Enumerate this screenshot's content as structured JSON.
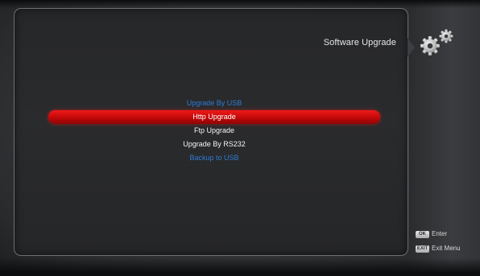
{
  "header": {
    "title": "Software Upgrade",
    "icon": "gears-icon"
  },
  "menu": {
    "items": [
      {
        "label": "Upgrade By USB",
        "state": "disabled"
      },
      {
        "label": "Http Upgrade",
        "state": "selected"
      },
      {
        "label": "Ftp Upgrade",
        "state": "normal"
      },
      {
        "label": "Upgrade By RS232",
        "state": "normal"
      },
      {
        "label": "Backup to USB",
        "state": "disabled"
      }
    ]
  },
  "hints": {
    "enter": {
      "key": "OK",
      "label": "Enter"
    },
    "exit": {
      "key": "EXIT",
      "label": "Exit Menu"
    }
  },
  "colors": {
    "highlight": "#d40e0e",
    "disabled_text": "#2f7bd4",
    "normal_text": "#f2f2f2"
  }
}
